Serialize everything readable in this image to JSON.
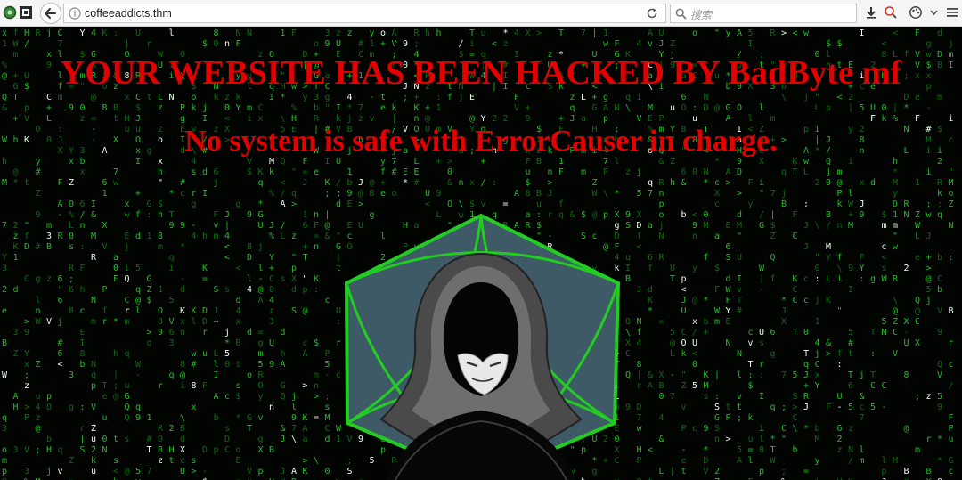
{
  "browser": {
    "url": "coffeeaddicts.thm",
    "search_placeholder": "搜索",
    "back_icon": "arrow-left-icon",
    "info_icon": "info-icon",
    "reload_icon": "reload-icon",
    "search_icon": "magnifier-icon",
    "download_icon": "download-icon",
    "colors": {
      "toolbar": "#f5f5f5",
      "border": "#cfcfcf"
    }
  },
  "page": {
    "headline": "YOUR WEBSITE HAS BEEN HACKED BY BadByte mf",
    "subheadline": "No system is safe with ErrorCauser in charge.",
    "emblem_icon": "hooded-hacker-emblem",
    "colors": {
      "headline": "#e50000",
      "rain": "#1fbf1f",
      "emblem_frame": "#22cc22",
      "emblem_fill": "#3e5a66"
    }
  }
}
